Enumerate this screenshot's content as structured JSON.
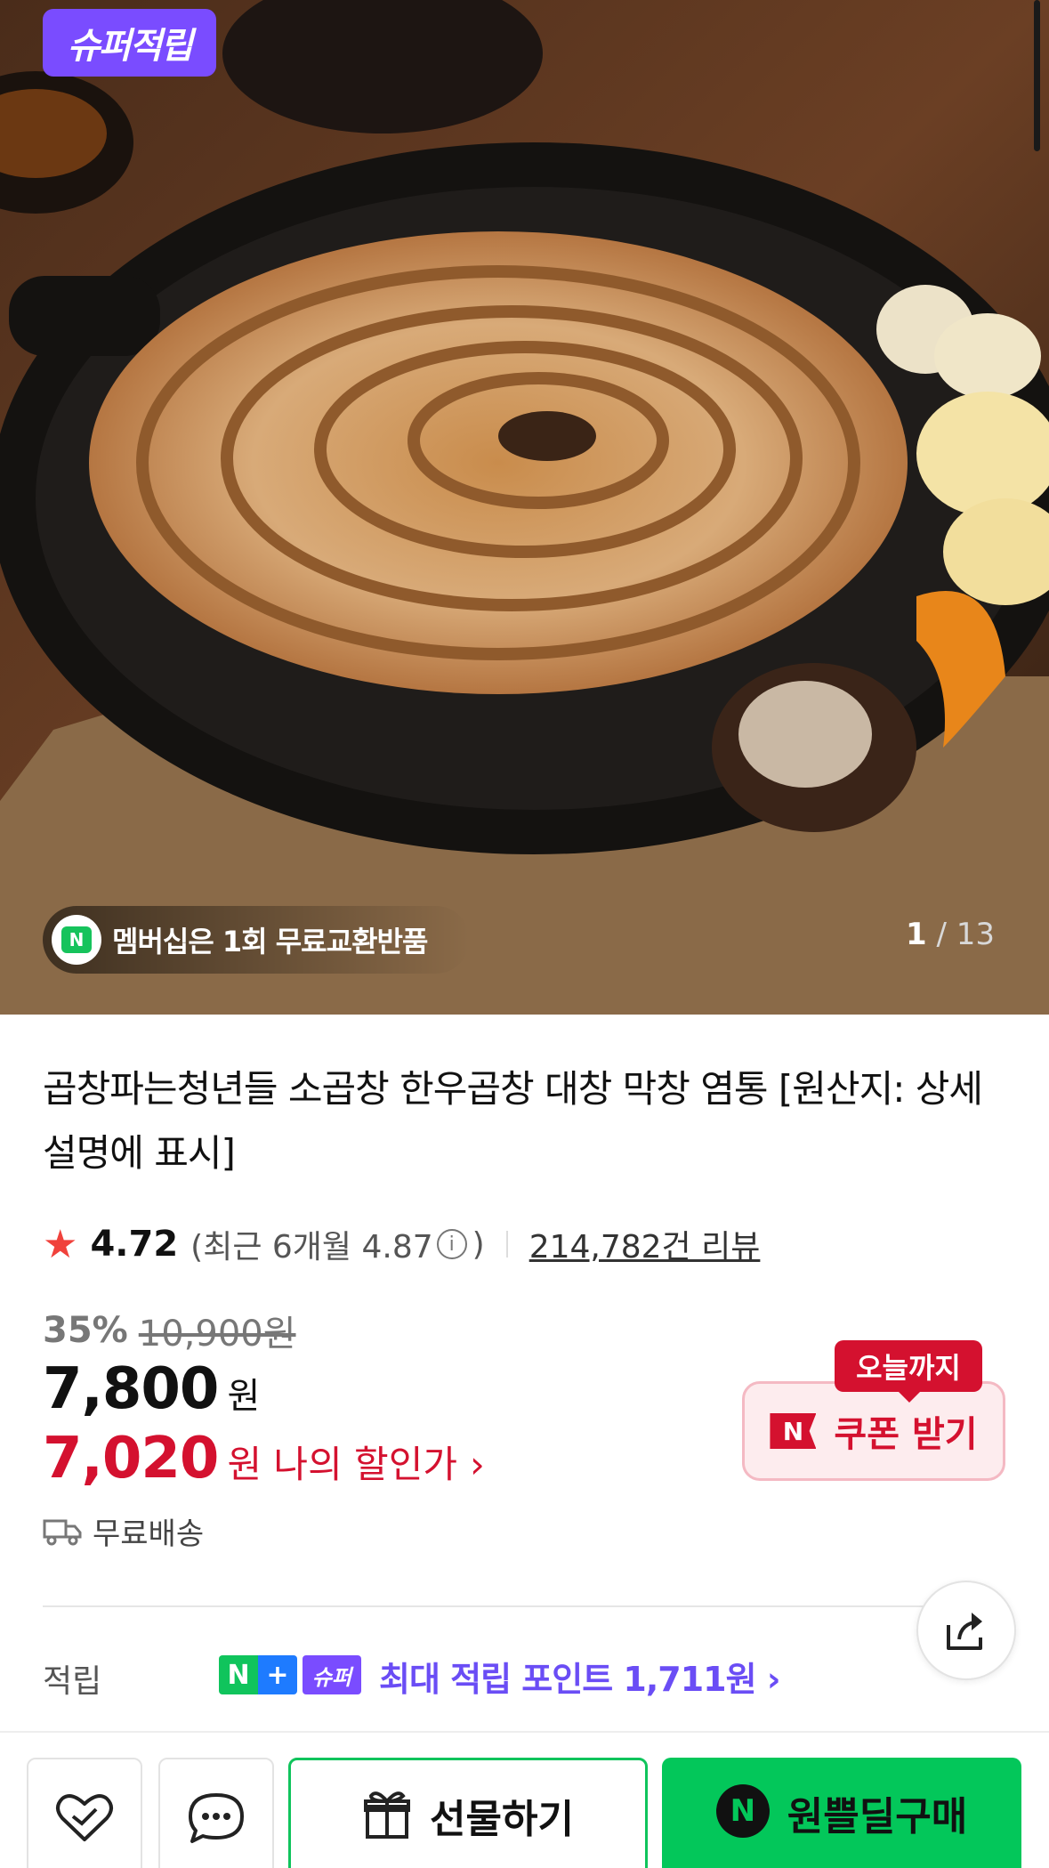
{
  "hero": {
    "badge": "슈퍼적립",
    "membership_text": "멤버십은 1회 무료교환반품",
    "membership_icon": "n-delivery-icon",
    "page_current": "1",
    "page_total": "/ 13"
  },
  "product": {
    "title": "곱창파는청년들 소곱창 한우곱창 대창 막창 염통 [원산지: 상세설명에 표시]",
    "rating": "4.72",
    "recent_open": "(최근 6개월 4.87",
    "recent_close": ")",
    "reviews": "214,782건 리뷰",
    "discount_pct": "35%",
    "original_price": "10,900원",
    "price": "7,800",
    "price_unit": "원",
    "my_price": "7,020",
    "my_price_label": "원 나의 할인가",
    "shipping": "무료배송"
  },
  "coupon": {
    "tag": "오늘까지",
    "button": "쿠폰 받기",
    "icon_letter": "N"
  },
  "points": {
    "label": "적립",
    "badge_n": "N",
    "badge_plus": "+",
    "badge_super": "슈퍼",
    "text": "최대 적립 포인트 1,711원"
  },
  "bottom_bar": {
    "gift_label": "선물하기",
    "buy_label": "원쁠딜구매",
    "buy_icon_letter": "N"
  },
  "colors": {
    "accent_red": "#d4112f",
    "naver_green": "#03c75a",
    "super_purple": "#7a4cff"
  }
}
